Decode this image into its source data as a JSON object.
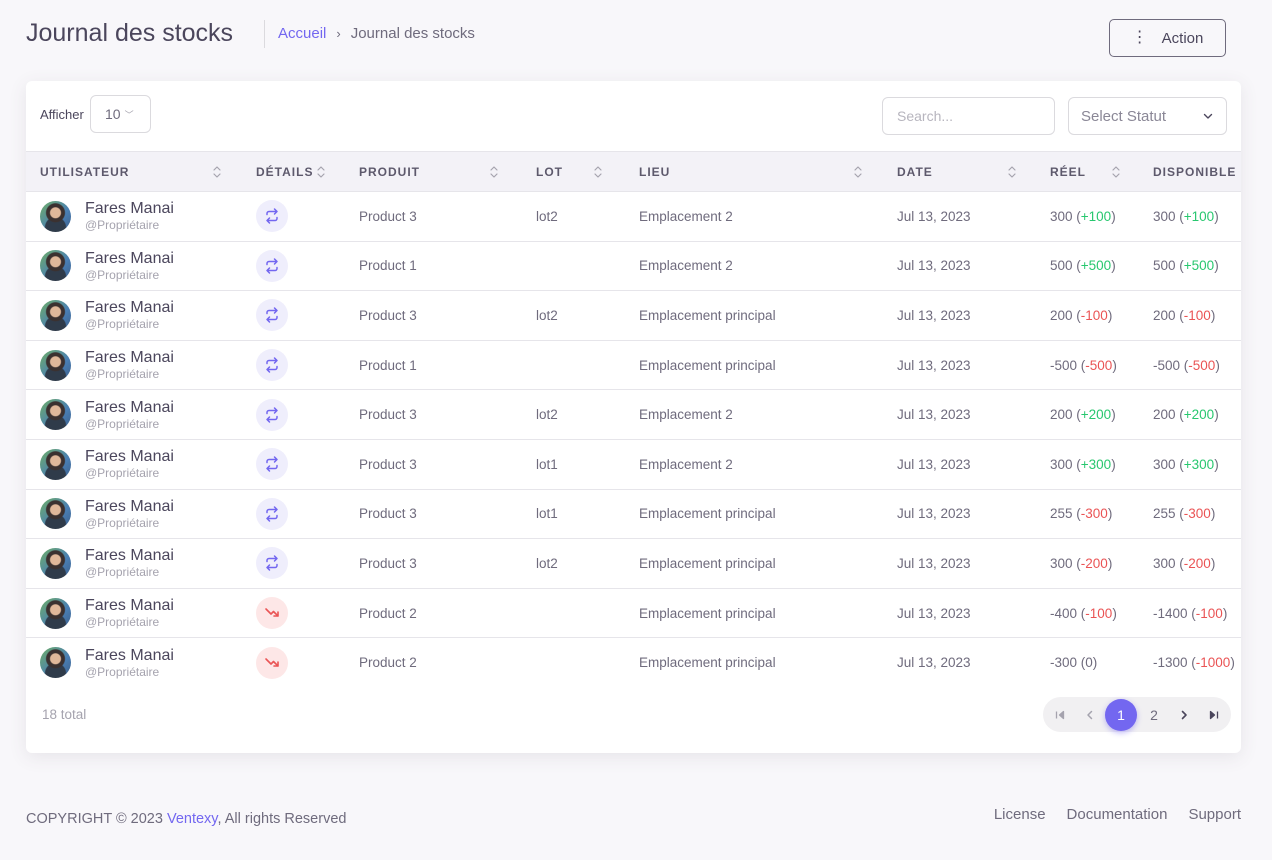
{
  "header": {
    "title": "Journal des stocks",
    "breadcrumb": {
      "home": "Accueil",
      "separator": "›",
      "current": "Journal des stocks"
    },
    "action_button": "Action"
  },
  "toolbar": {
    "show_label": "Afficher",
    "page_size": "10",
    "search_placeholder": "Search...",
    "status_placeholder": "Select Statut"
  },
  "table": {
    "columns": [
      "UTILISATEUR",
      "DÉTAILS",
      "PRODUIT",
      "LOT",
      "LIEU",
      "DATE",
      "RÉEL",
      "DISPONIBLE"
    ],
    "rows": [
      {
        "name": "Fares Manai",
        "role": "@Propriétaire",
        "detail_icon": "transfer-icon",
        "product": "Product 3",
        "lot": "lot2",
        "location": "Emplacement 2",
        "date": "Jul 13, 2023",
        "real": "300",
        "real_delta": "+100",
        "avail": "300",
        "avail_delta": "+100"
      },
      {
        "name": "Fares Manai",
        "role": "@Propriétaire",
        "detail_icon": "transfer-icon",
        "product": "Product 1",
        "lot": "",
        "location": "Emplacement 2",
        "date": "Jul 13, 2023",
        "real": "500",
        "real_delta": "+500",
        "avail": "500",
        "avail_delta": "+500"
      },
      {
        "name": "Fares Manai",
        "role": "@Propriétaire",
        "detail_icon": "transfer-icon",
        "product": "Product 3",
        "lot": "lot2",
        "location": "Emplacement principal",
        "date": "Jul 13, 2023",
        "real": "200",
        "real_delta": "-100",
        "avail": "200",
        "avail_delta": "-100"
      },
      {
        "name": "Fares Manai",
        "role": "@Propriétaire",
        "detail_icon": "transfer-icon",
        "product": "Product 1",
        "lot": "",
        "location": "Emplacement principal",
        "date": "Jul 13, 2023",
        "real": "-500",
        "real_delta": "-500",
        "avail": "-500",
        "avail_delta": "-500"
      },
      {
        "name": "Fares Manai",
        "role": "@Propriétaire",
        "detail_icon": "transfer-icon",
        "product": "Product 3",
        "lot": "lot2",
        "location": "Emplacement 2",
        "date": "Jul 13, 2023",
        "real": "200",
        "real_delta": "+200",
        "avail": "200",
        "avail_delta": "+200"
      },
      {
        "name": "Fares Manai",
        "role": "@Propriétaire",
        "detail_icon": "transfer-icon",
        "product": "Product 3",
        "lot": "lot1",
        "location": "Emplacement 2",
        "date": "Jul 13, 2023",
        "real": "300",
        "real_delta": "+300",
        "avail": "300",
        "avail_delta": "+300"
      },
      {
        "name": "Fares Manai",
        "role": "@Propriétaire",
        "detail_icon": "transfer-icon",
        "product": "Product 3",
        "lot": "lot1",
        "location": "Emplacement principal",
        "date": "Jul 13, 2023",
        "real": "255",
        "real_delta": "-300",
        "avail": "255",
        "avail_delta": "-300"
      },
      {
        "name": "Fares Manai",
        "role": "@Propriétaire",
        "detail_icon": "transfer-icon",
        "product": "Product 3",
        "lot": "lot2",
        "location": "Emplacement principal",
        "date": "Jul 13, 2023",
        "real": "300",
        "real_delta": "-200",
        "avail": "300",
        "avail_delta": "-200"
      },
      {
        "name": "Fares Manai",
        "role": "@Propriétaire",
        "detail_icon": "trend-down-icon",
        "product": "Product 2",
        "lot": "",
        "location": "Emplacement principal",
        "date": "Jul 13, 2023",
        "real": "-400",
        "real_delta": "-100",
        "avail": "-1400",
        "avail_delta": "-100"
      },
      {
        "name": "Fares Manai",
        "role": "@Propriétaire",
        "detail_icon": "trend-down-icon",
        "product": "Product 2",
        "lot": "",
        "location": "Emplacement principal",
        "date": "Jul 13, 2023",
        "real": "-300",
        "real_delta": "0",
        "avail": "-1300",
        "avail_delta": "-1000"
      }
    ]
  },
  "pagination": {
    "total": "18 total",
    "pages": [
      "1",
      "2"
    ],
    "current": "1"
  },
  "footer": {
    "copyright_prefix": "COPYRIGHT © 2023",
    "brand": "Ventexy",
    "copyright_suffix": ", All rights Reserved",
    "links": [
      "License",
      "Documentation",
      "Support"
    ]
  },
  "colors": {
    "primary": "#7367f0",
    "positive": "#28c76f",
    "negative": "#ea5455",
    "transfer_badge_bg": "#efeefc",
    "out_badge_bg": "#fde7e7"
  }
}
